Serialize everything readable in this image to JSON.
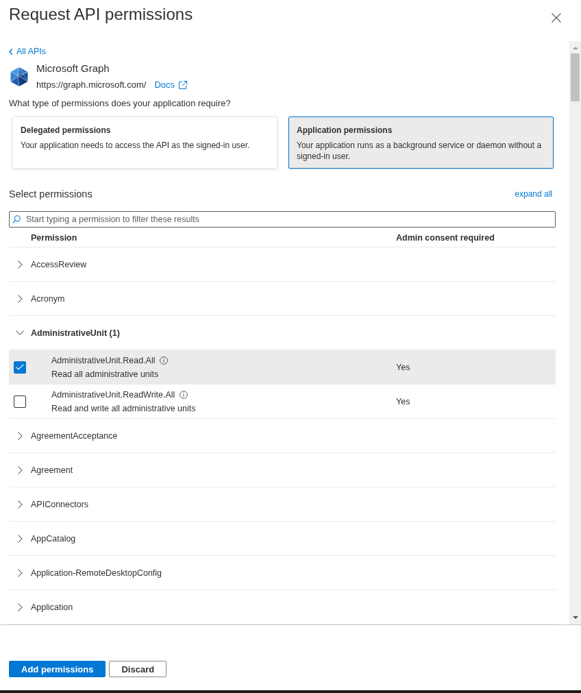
{
  "panel": {
    "title": "Request API permissions"
  },
  "back_link": {
    "label": "All APIs"
  },
  "api": {
    "name": "Microsoft Graph",
    "url": "https://graph.microsoft.com/",
    "docs_link": "Docs"
  },
  "question": "What type of permissions does your application require?",
  "permission_types": [
    {
      "title": "Delegated permissions",
      "description": "Your application needs to access the API as the signed-in user.",
      "selected": false
    },
    {
      "title": "Application permissions",
      "description": "Your application runs as a background service or daemon without a signed-in user.",
      "selected": true
    }
  ],
  "select_permissions": {
    "heading": "Select permissions",
    "expand_all": "expand all",
    "search": {
      "placeholder": "Start typing a permission to filter these results"
    }
  },
  "table": {
    "columns": [
      "Permission",
      "Admin consent required"
    ],
    "groups": [
      {
        "name": "AccessReview",
        "expanded": false
      },
      {
        "name": "Acronym",
        "expanded": false
      },
      {
        "name": "AdministrativeUnit (1)",
        "expanded": true,
        "children": [
          {
            "name": "AdministrativeUnit.Read.All",
            "description": "Read all administrative units",
            "admin_consent": "Yes",
            "checked": true
          },
          {
            "name": "AdministrativeUnit.ReadWrite.All",
            "description": "Read and write all administrative units",
            "admin_consent": "Yes",
            "checked": false
          }
        ]
      },
      {
        "name": "AgreementAcceptance",
        "expanded": false
      },
      {
        "name": "Agreement",
        "expanded": false
      },
      {
        "name": "APIConnectors",
        "expanded": false
      },
      {
        "name": "AppCatalog",
        "expanded": false
      },
      {
        "name": "Application-RemoteDesktopConfig",
        "expanded": false
      },
      {
        "name": "Application",
        "expanded": false
      }
    ]
  },
  "buttons": [
    {
      "label": "Add permissions",
      "kind": "primary"
    },
    {
      "label": "Discard",
      "kind": "secondary"
    }
  ]
}
